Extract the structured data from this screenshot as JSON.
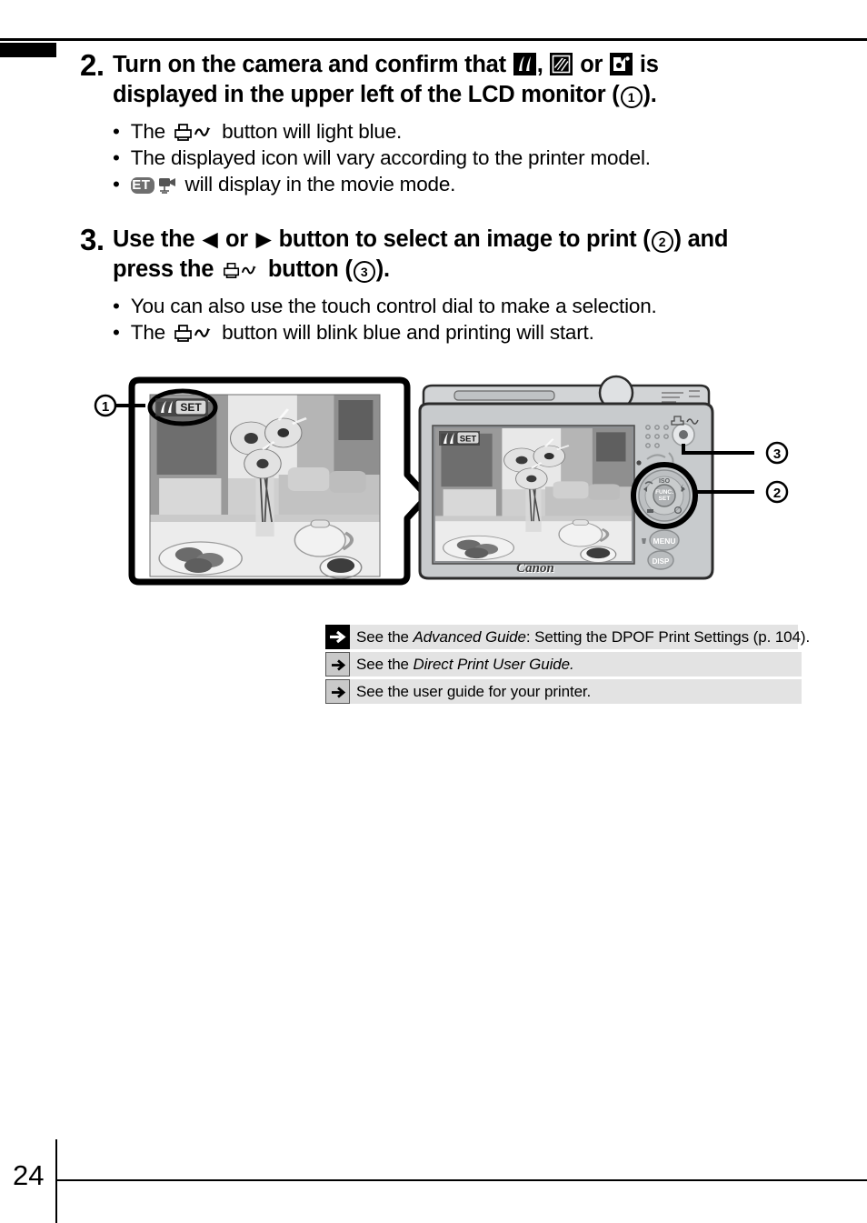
{
  "page": {
    "number": "24"
  },
  "steps": [
    {
      "number": "2.",
      "heading_part1": "Turn on the camera and confirm that",
      "heading_comma": ",",
      "heading_or": "or",
      "heading_part2": "is",
      "heading_line2_pre": "displayed in the upper left of the LCD monitor (",
      "heading_line2_marker": "1",
      "heading_line2_post": ").",
      "icons": [
        "pictbridge-icon",
        "canon-direct-print-icon",
        "bubble-jet-direct-icon"
      ],
      "bullets": [
        {
          "pre": "The",
          "icon": "print-share-button-icon",
          "post": "button will light blue."
        },
        {
          "text": "The displayed icon will vary according to the printer model."
        },
        {
          "badge": "SET",
          "icon": "movie-camera-icon",
          "post": "will display in the movie mode."
        }
      ]
    },
    {
      "number": "3.",
      "heading_pre": "Use the",
      "heading_left_arrow": "◀",
      "heading_or": "or",
      "heading_right_arrow": "▶",
      "heading_mid": "button to select an image to print (",
      "heading_marker1": "2",
      "heading_after_marker1": ") and",
      "heading_line2_pre": "press the",
      "heading_line2_icon": "print-share-button-icon",
      "heading_line2_mid": "button (",
      "heading_marker2": "3",
      "heading_line2_post": ").",
      "bullets": [
        {
          "text": "You can also use the touch control dial to make a selection."
        },
        {
          "pre": "The",
          "icon": "print-share-button-icon",
          "post": "button will blink blue and printing will start."
        }
      ]
    }
  ],
  "illustration": {
    "callouts": [
      {
        "label": "1",
        "target": "lcd-print-icon-highlight"
      },
      {
        "label": "3",
        "target": "print-share-button"
      },
      {
        "label": "2",
        "target": "control-dial"
      }
    ],
    "lcd_badge": "SET",
    "camera_brand": "Canon",
    "camera_buttons": [
      "MENU",
      "DISP",
      "FUNC. SET",
      "ISO"
    ]
  },
  "reference_table": {
    "rows": [
      {
        "icon": "arrow-right-icon",
        "style": "dark",
        "segments": [
          {
            "text": "See the ",
            "italic": false
          },
          {
            "text": "Advanced Guide",
            "italic": true
          },
          {
            "text": ": Setting the DPOF Print Settings (p. 104).",
            "italic": false
          }
        ],
        "plain": "See the Advanced Guide: Setting the DPOF Print Settings (p. 104)."
      },
      {
        "icon": "arrow-right-icon",
        "style": "light",
        "segments": [
          {
            "text": "See the ",
            "italic": false
          },
          {
            "text": "Direct Print User Guide.",
            "italic": true
          }
        ],
        "plain": "See the Direct Print User Guide."
      },
      {
        "icon": "arrow-right-icon",
        "style": "light",
        "segments": [
          {
            "text": "See the user guide for your printer.",
            "italic": false
          }
        ],
        "plain": "See the user guide for your printer."
      }
    ]
  }
}
